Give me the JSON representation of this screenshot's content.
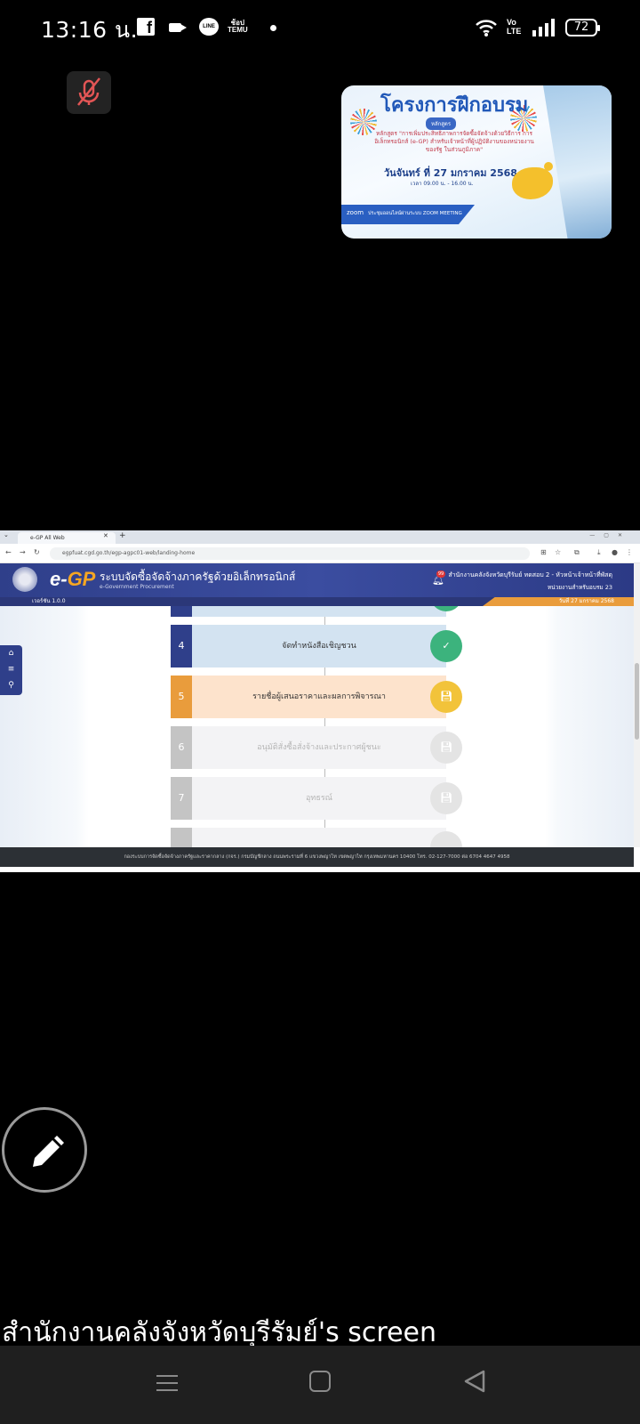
{
  "status_bar": {
    "time": "13:16 น.",
    "battery": "72",
    "icons": [
      "facebook-icon",
      "video-call-icon",
      "line-icon",
      "temu-icon",
      "dot-icon",
      "wifi-icon",
      "volte-icon",
      "signal-icon",
      "battery-icon"
    ],
    "temu_top": "ช้อป",
    "temu_bottom": "TEMU",
    "volte_top": "Vo",
    "volte_bottom": "LTE",
    "line_label": "LINE"
  },
  "thumbnail": {
    "title": "โครงการฝึกอบรม",
    "pill": "หลักสูตร",
    "course_text": "หลักสูตร \"การเพิ่มประสิทธิภาพการจัดซื้อจัดจ้างด้วยวิธีการ การอิเล็กทรอนิกส์ (e-GP) สำหรับเจ้าหน้าที่ผู้ปฏิบัติงานของหน่วยงานของรัฐ ในส่วนภูมิภาค\"",
    "date": "วันจันทร์ ที่ 27 มกราคม 2568",
    "time_text": "เวลา 09.00 น. - 16.00 น.",
    "zoom_label": "zoom",
    "meeting_text": "ประชุมออนไลน์ผ่านระบบ ZOOM MEETING"
  },
  "browser": {
    "tab_title": "e-GP All Web",
    "url": "egpfuat.cgd.go.th/egp-agpc01-web/landing-home",
    "egp_title": "ระบบจัดซื้อจัดจ้างภาครัฐด้วยอิเล็กทรอนิกส์",
    "egp_subtitle": "e-Government Procurement",
    "notification_count": "99",
    "office": "สำนักงานคลังจังหวัดบุรีรัมย์ ทดสอบ 2 - หัวหน้าเจ้าหน้าที่พัสดุ",
    "unit": "หน่วยงานสำหรับอบรม 23",
    "version": "เวอร์ชัน 1.0.0",
    "date": "วันที่ 27 มกราคม 2568",
    "footer": "กองระบบการจัดซื้อจัดจ้างภาครัฐและราคากลาง (กจร.) กรมบัญชีกลาง ถนนพระรามที่ 6 แขวงพญาไท เขตพญาไท กรุงเทพมหานคร 10400 โทร. 02-127-7000 ต่อ 6704 4647 4958",
    "steps": [
      {
        "number": "4",
        "label": "จัดทำหนังสือเชิญชวน",
        "status": "done"
      },
      {
        "number": "5",
        "label": "รายชื่อผู้เสนอราคาและผลการพิจารณา",
        "status": "current"
      },
      {
        "number": "6",
        "label": "อนุมัติสั่งซื้อสั่งจ้างและประกาศผู้ชนะ",
        "status": "pending"
      },
      {
        "number": "7",
        "label": "อุทธรณ์",
        "status": "pending"
      }
    ],
    "colors": {
      "header": "#3b4da0",
      "done_num": "#2f3f8a",
      "done_bg": "#d3e3f1",
      "check": "#3cb37d",
      "current_num": "#e99c3c",
      "current_bg": "#fde3cc",
      "save": "#f2c33a",
      "pending_num": "#c4c4c4",
      "pending_bg": "#f3f3f5"
    }
  },
  "caption": "สำนักงานคลังจังหวัดบุรีรัมย์'s screen"
}
